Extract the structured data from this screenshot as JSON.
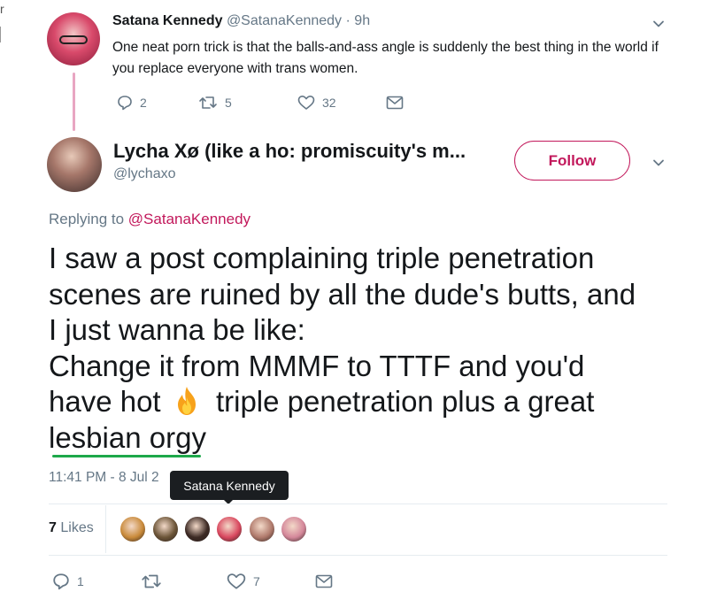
{
  "parent_tweet": {
    "display_name": "Satana Kennedy",
    "handle": "@SatanaKennedy",
    "separator": "·",
    "time": "9h",
    "text": "One neat porn trick is that the balls-and-ass angle is suddenly the best thing in the world if you replace everyone with trans women.",
    "replies": "2",
    "retweets": "5",
    "likes": "32"
  },
  "tweet": {
    "display_name": "Lycha Xø (like a ho: promiscuity's m...",
    "handle": "@lychaxo",
    "follow_label": "Follow",
    "replying_prefix": "Replying to",
    "replying_mention": "@SatanaKennedy",
    "text_line1": "I saw a post complaining triple penetration",
    "text_line2": "scenes are ruined by all the dude's butts, and",
    "text_line3": "I just wanna be like:",
    "text_line4": "Change it from MMMF to TTTF and you'd",
    "text_line5a": "have hot",
    "text_line5b": "triple penetration plus a great",
    "text_line6": "lesbian orgy",
    "fire_emoji_icon": "fire-emoji",
    "timestamp": "11:41 PM - 8 Jul 2",
    "likes_number": "7",
    "likes_word": "Likes",
    "tooltip": "Satana Kennedy",
    "reply_count": "1",
    "like_count": "7"
  },
  "colors": {
    "accent": "#c2185b",
    "muted": "#657786",
    "thread_line": "#e8a6c2",
    "underline": "#1ea84a",
    "tooltip_bg": "#1b1e21"
  },
  "likers": [
    {
      "name": "liker-avatar-1",
      "color": "#c98a3a"
    },
    {
      "name": "liker-avatar-2",
      "color": "#6b5437"
    },
    {
      "name": "liker-avatar-3",
      "color": "#3c2a24"
    },
    {
      "name": "liker-avatar-4",
      "color": "#d9485f"
    },
    {
      "name": "liker-avatar-5",
      "color": "#b07a6c"
    },
    {
      "name": "liker-avatar-6",
      "color": "#d4879a"
    }
  ]
}
